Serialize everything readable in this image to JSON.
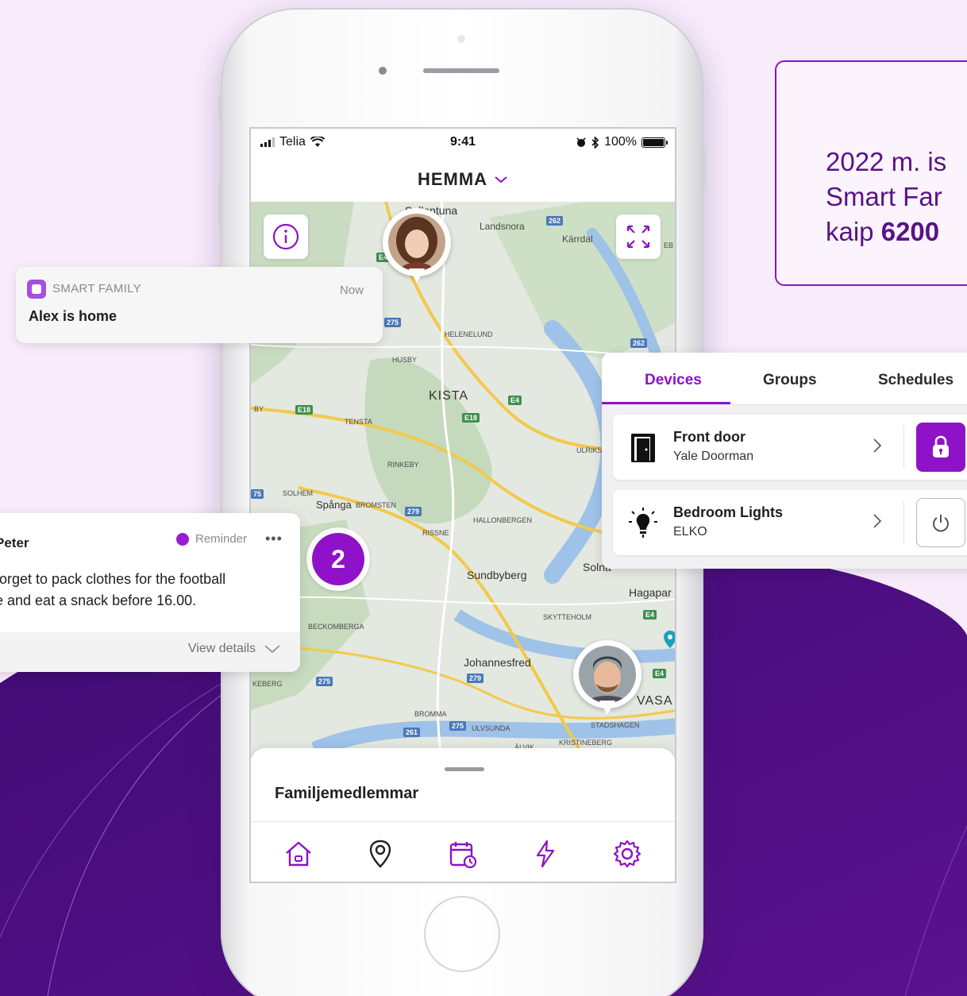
{
  "status_bar": {
    "carrier": "Telia",
    "time": "9:41",
    "battery": "100%"
  },
  "header": {
    "title": "HEMMA"
  },
  "map": {
    "labels": [
      "Sollentuna",
      "Landsnora",
      "Kärrdal",
      "HELENELUND",
      "HUSBY",
      "KISTA",
      "TENSTA",
      "RINKEBY",
      "ULRIKS",
      "SOLHEM",
      "Spånga",
      "BROMSTEN",
      "HALLONBERGEN",
      "RISSNE",
      "Sundbyberg",
      "Solna",
      "Hagapar",
      "SKYTTEHOLM",
      "BECKOMBERGA",
      "Johannesfred",
      "VASA",
      "BROMMA",
      "ULVSUNDA",
      "STADSHAGEN",
      "KRISTINEBERG",
      "ÄLVIK",
      "KEBERG",
      "BY",
      "EB"
    ],
    "road_tags": [
      "262",
      "275",
      "262",
      "E4",
      "E18",
      "E18",
      "279",
      "E4",
      "275",
      "279",
      "E4",
      "275",
      "261",
      "E4",
      "75"
    ],
    "cluster_count": "2"
  },
  "sheet": {
    "title": "Familjemedlemmar"
  },
  "bottom_nav": [
    "home-icon",
    "location-icon",
    "calendar-icon",
    "energy-icon",
    "settings-icon"
  ],
  "notification": {
    "app": "SMART FAMILY",
    "time": "Now",
    "message": "Alex is home"
  },
  "reminder": {
    "name": "Peter",
    "tag": "Reminder",
    "more": "•••",
    "line1": "forget to pack clothes for the football",
    "line2": "e and eat a snack before 16.00.",
    "view_details": "View details"
  },
  "devices": {
    "tabs": [
      "Devices",
      "Groups",
      "Schedules"
    ],
    "items": [
      {
        "name": "Front door",
        "model": "Yale Doorman"
      },
      {
        "name": "Bedroom Lights",
        "model": "ELKO"
      }
    ]
  },
  "info": {
    "line1": "2022 m. is",
    "line2": "Smart Far",
    "line3_prefix": "kaip ",
    "line3_bold": "6200"
  },
  "colors": {
    "accent": "#8d12c6",
    "background": "#f8ecfb",
    "blob": "#4a0d7a"
  }
}
